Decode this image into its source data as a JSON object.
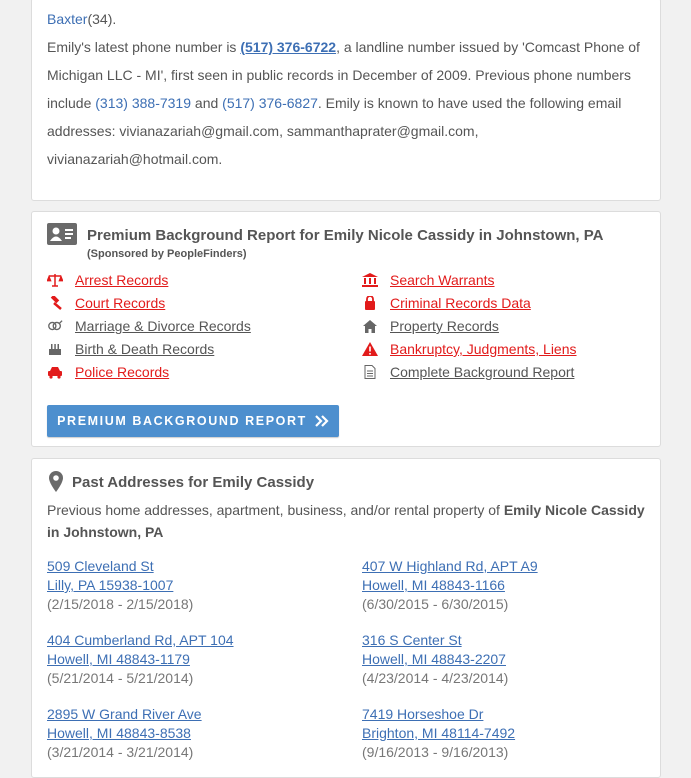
{
  "bio": {
    "frag1_name": "Baxter",
    "frag1_tail": "(34).",
    "phone_intro": "Emily's latest phone number is ",
    "phone_main": "(517) 376-6722",
    "phone_desc": ", a landline number issued by 'Comcast Phone of Michigan LLC - MI', first seen in public records in December of 2009. Previous phone numbers include ",
    "phone_prev1": "(313) 388-7319",
    "and_word": " and ",
    "phone_prev2": "(517) 376-6827",
    "email_text": ". Emily is known to have used the following email addresses: vivianazariah@gmail.com, sammanthaprater@gmail.com, vivianazariah@hotmail.com."
  },
  "premium": {
    "title": "Premium Background Report for Emily Nicole Cassidy in Johnstown, PA",
    "sponsor": "(Sponsored by PeopleFinders)",
    "records_left": [
      {
        "label": "Arrest Records",
        "icon": "scales-icon",
        "color": "red"
      },
      {
        "label": "Court Records",
        "icon": "gavel-icon",
        "color": "red"
      },
      {
        "label": "Marriage & Divorce Records",
        "icon": "gender-icon",
        "color": "gray"
      },
      {
        "label": "Birth & Death Records",
        "icon": "cake-icon",
        "color": "gray"
      },
      {
        "label": "Police Records",
        "icon": "police-car-icon",
        "color": "red"
      }
    ],
    "records_right": [
      {
        "label": "Search Warrants",
        "icon": "courthouse-icon",
        "color": "red"
      },
      {
        "label": "Criminal Records Data",
        "icon": "handcuffs-icon",
        "color": "red"
      },
      {
        "label": "Property Records",
        "icon": "home-icon",
        "color": "gray"
      },
      {
        "label": "Bankruptcy, Judgments, Liens",
        "icon": "warning-icon",
        "color": "red"
      },
      {
        "label": "Complete Background Report",
        "icon": "document-icon",
        "color": "gray"
      }
    ],
    "button_label": "PREMIUM BACKGROUND REPORT"
  },
  "addresses": {
    "title": "Past Addresses for Emily Cassidy",
    "intro_plain": "Previous home addresses, apartment, business, and/or rental property of ",
    "intro_bold": "Emily Nicole Cassidy in Johnstown, PA",
    "items": [
      {
        "line1": "509 Cleveland St",
        "line2": "Lilly, PA 15938-1007",
        "dates": "(2/15/2018 - 2/15/2018)"
      },
      {
        "line1": "407 W Highland Rd, APT A9",
        "line2": "Howell, MI 48843-1166",
        "dates": "(6/30/2015 - 6/30/2015)"
      },
      {
        "line1": "404 Cumberland Rd, APT 104",
        "line2": "Howell, MI 48843-1179",
        "dates": "(5/21/2014 - 5/21/2014)"
      },
      {
        "line1": "316 S Center St",
        "line2": "Howell, MI 48843-2207",
        "dates": "(4/23/2014 - 4/23/2014)"
      },
      {
        "line1": "2895 W Grand River Ave",
        "line2": "Howell, MI 48843-8538",
        "dates": "(3/21/2014 - 3/21/2014)"
      },
      {
        "line1": "7419 Horseshoe Dr",
        "line2": "Brighton, MI 48114-7492",
        "dates": "(9/16/2013 - 9/16/2013)"
      }
    ]
  },
  "colors": {
    "link": "#3d6fb4",
    "red": "#e21b1b",
    "button": "#4d8fce"
  }
}
